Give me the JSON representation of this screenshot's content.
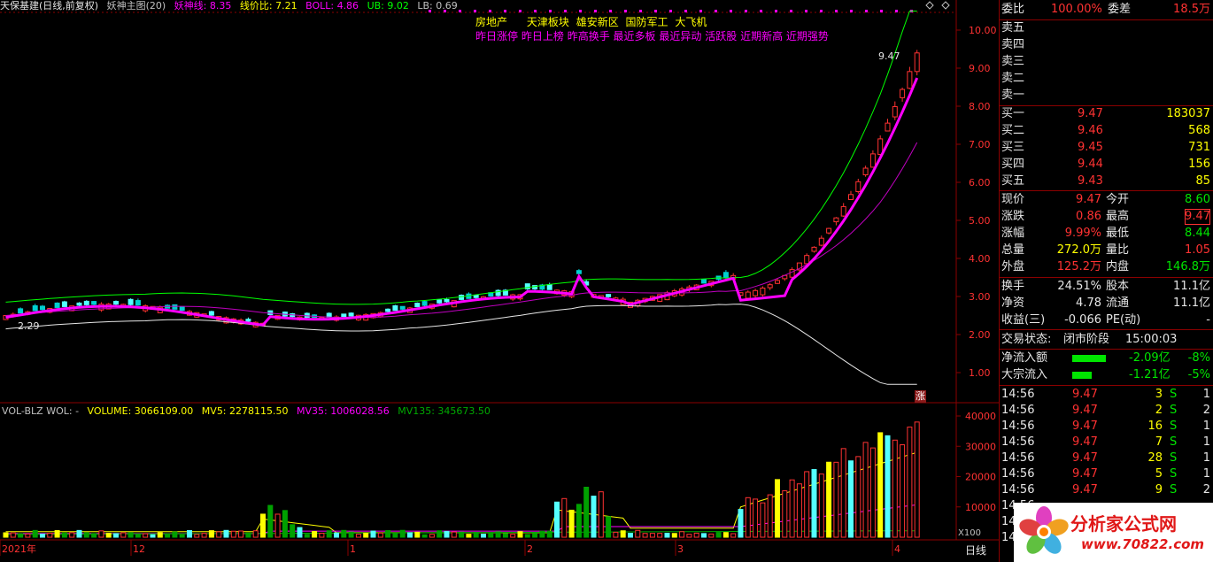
{
  "header": {
    "stock": "天保基建(日线,前复权)",
    "indicator": "妖神主图(20)",
    "items": [
      {
        "label": "妖神线: 8.35",
        "color": "#ff00ff"
      },
      {
        "label": "线价比: 7.21",
        "color": "#ffff00"
      },
      {
        "label": "BOLL: 4.86",
        "color": "#ff00ff"
      },
      {
        "label": "UB: 9.02",
        "color": "#00ff00"
      },
      {
        "label": "LB: 0.69",
        "color": "#c0c0c0"
      }
    ]
  },
  "concepts": {
    "line1": [
      "房地产",
      "天津板块",
      "雄安新区",
      "国防军工",
      "大飞机"
    ],
    "line2": [
      "昨日涨停",
      "昨日上榜",
      "昨高换手",
      "最近多板",
      "最近异动",
      "活跃股",
      "近期新高",
      "近期强势"
    ]
  },
  "price_axis": [
    "10.00",
    "9.00",
    "8.00",
    "7.00",
    "6.00",
    "5.00",
    "4.00",
    "3.00",
    "2.00",
    "1.00"
  ],
  "low_label": "2.29",
  "high_label": "9.47",
  "zhang_badge": "涨",
  "volume_header": {
    "name": "VOL-BLZ WOL: -",
    "items": [
      {
        "label": "VOLUME: 3066109.00",
        "color": "#ffff00"
      },
      {
        "label": "MV5: 2278115.50",
        "color": "#ffff00"
      },
      {
        "label": "MV35: 1006028.56",
        "color": "#ff00ff"
      },
      {
        "label": "MV135: 345673.50",
        "color": "#00aa00"
      }
    ]
  },
  "volume_axis": [
    "40000",
    "30000",
    "20000",
    "10000"
  ],
  "volume_unit": "X100",
  "time_axis": [
    "2021年",
    "12",
    "1",
    "2",
    "3",
    "4"
  ],
  "period_label": "日线",
  "panel": {
    "weibi": {
      "label": "委比",
      "value": "100.00%",
      "label2": "委差",
      "value2": "18.5万"
    },
    "asks": [
      {
        "label": "卖五",
        "price": "",
        "vol": ""
      },
      {
        "label": "卖四",
        "price": "",
        "vol": ""
      },
      {
        "label": "卖三",
        "price": "",
        "vol": ""
      },
      {
        "label": "卖二",
        "price": "",
        "vol": ""
      },
      {
        "label": "卖一",
        "price": "",
        "vol": ""
      }
    ],
    "bids": [
      {
        "label": "买一",
        "price": "9.47",
        "vol": "183037"
      },
      {
        "label": "买二",
        "price": "9.46",
        "vol": "568"
      },
      {
        "label": "买三",
        "price": "9.45",
        "vol": "731"
      },
      {
        "label": "买四",
        "price": "9.44",
        "vol": "156"
      },
      {
        "label": "买五",
        "price": "9.43",
        "vol": "85"
      }
    ],
    "quote": [
      {
        "l1": "现价",
        "v1": "9.47",
        "c1": "red",
        "l2": "今开",
        "v2": "8.60",
        "c2": "green"
      },
      {
        "l1": "涨跌",
        "v1": "0.86",
        "c1": "red",
        "l2": "最高",
        "v2": "9.47",
        "c2": "red"
      },
      {
        "l1": "涨幅",
        "v1": "9.99%",
        "c1": "red",
        "l2": "最低",
        "v2": "8.44",
        "c2": "green"
      },
      {
        "l1": "总量",
        "v1": "272.0万",
        "c1": "yellow",
        "l2": "量比",
        "v2": "1.05",
        "c2": "red"
      },
      {
        "l1": "外盘",
        "v1": "125.2万",
        "c1": "red",
        "l2": "内盘",
        "v2": "146.8万",
        "c2": "green"
      }
    ],
    "fund": [
      {
        "l1": "换手",
        "v1": "24.51%",
        "l2": "股本",
        "v2": "11.1亿"
      },
      {
        "l1": "净资",
        "v1": "4.78",
        "l2": "流通",
        "v2": "11.1亿"
      },
      {
        "l1": "收益(三)",
        "v1": "-0.066",
        "l2": "PE(动)",
        "v2": "-"
      }
    ],
    "status": {
      "label": "交易状态:",
      "value": "闭市阶段",
      "time": "15:00:03"
    },
    "flows": [
      {
        "label": "净流入额",
        "value": "-2.09亿",
        "pct": "-8%",
        "fill": 0.8
      },
      {
        "label": "大宗流入",
        "value": "-1.21亿",
        "pct": "-5%",
        "fill": 0.45
      }
    ],
    "ticks": [
      {
        "time": "14:56",
        "price": "9.47",
        "vol": "3",
        "side": "S",
        "n": "1"
      },
      {
        "time": "14:56",
        "price": "9.47",
        "vol": "2",
        "side": "S",
        "n": "2"
      },
      {
        "time": "14:56",
        "price": "9.47",
        "vol": "16",
        "side": "S",
        "n": "1"
      },
      {
        "time": "14:56",
        "price": "9.47",
        "vol": "7",
        "side": "S",
        "n": "1"
      },
      {
        "time": "14:56",
        "price": "9.47",
        "vol": "28",
        "side": "S",
        "n": "1"
      },
      {
        "time": "14:56",
        "price": "9.47",
        "vol": "5",
        "side": "S",
        "n": "1"
      },
      {
        "time": "14:56",
        "price": "9.47",
        "vol": "9",
        "side": "S",
        "n": "2"
      },
      {
        "time": "14:56",
        "price": "",
        "vol": "",
        "side": "",
        "n": ""
      },
      {
        "time": "14:5",
        "price": "",
        "vol": "",
        "side": "",
        "n": ""
      },
      {
        "time": "14:5",
        "price": "",
        "vol": "",
        "side": "",
        "n": ""
      }
    ]
  },
  "logo": {
    "title": "分析家公式网",
    "url": "www.70822.com"
  }
}
